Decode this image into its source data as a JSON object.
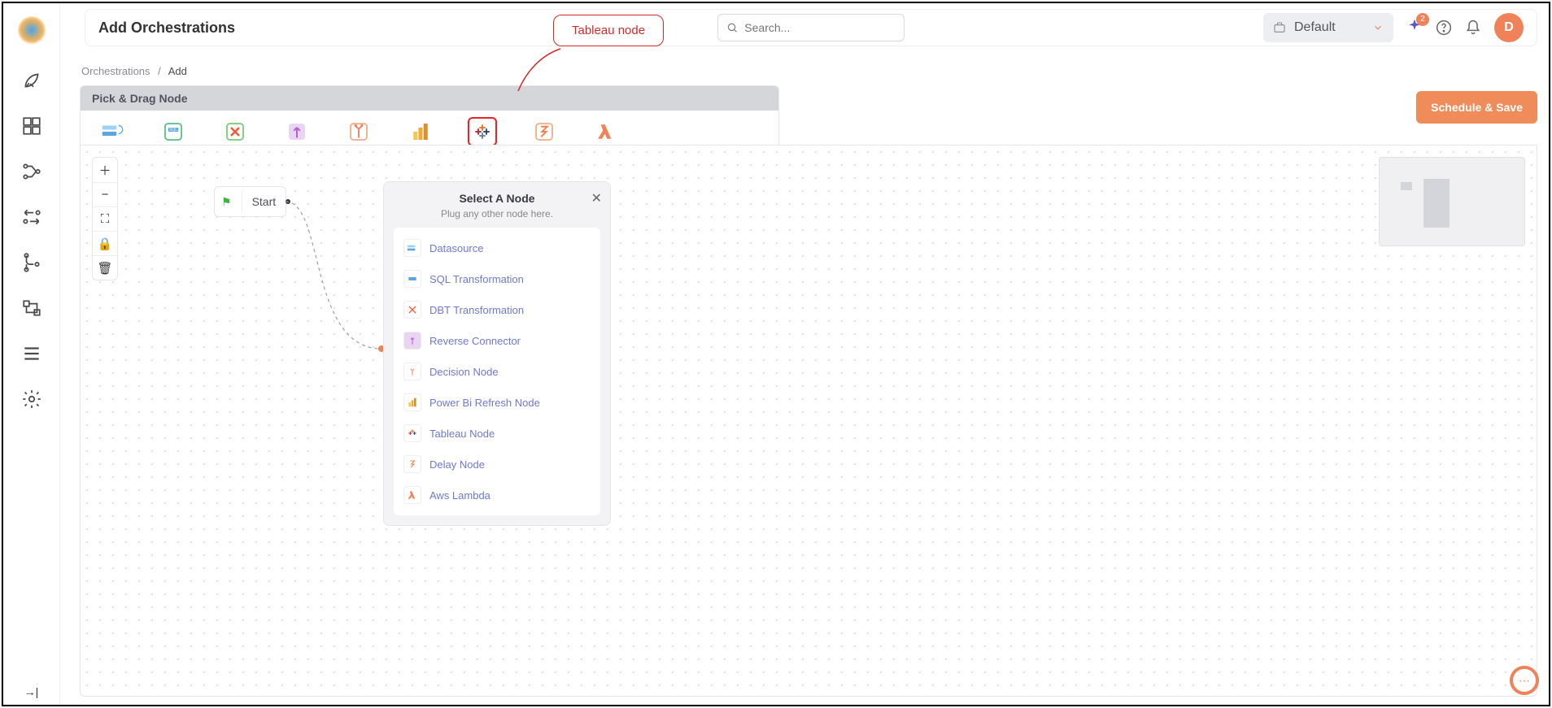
{
  "header": {
    "title": "Add Orchestrations",
    "search_placeholder": "Search..."
  },
  "workspace": {
    "selected": "Default"
  },
  "sparkle_badge": {
    "count": "2"
  },
  "avatar": {
    "initial": "D"
  },
  "breadcrumb": {
    "root": "Orchestrations",
    "current": "Add"
  },
  "palette_title": "Pick & Drag Node",
  "save_button": "Schedule & Save",
  "start_node": {
    "label": "Start"
  },
  "callout": {
    "text": "Tableau node"
  },
  "popup": {
    "title": "Select A Node",
    "subtitle": "Plug any other node here.",
    "items": [
      {
        "label": "Datasource"
      },
      {
        "label": "SQL Transformation"
      },
      {
        "label": "DBT Transformation"
      },
      {
        "label": "Reverse Connector"
      },
      {
        "label": "Decision Node"
      },
      {
        "label": "Power Bi Refresh Node"
      },
      {
        "label": "Tableau Node"
      },
      {
        "label": "Delay Node"
      },
      {
        "label": "Aws Lambda"
      }
    ]
  }
}
